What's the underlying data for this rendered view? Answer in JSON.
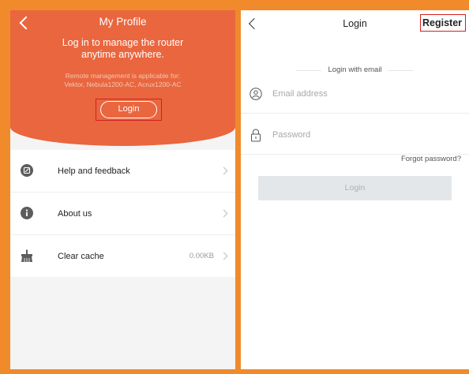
{
  "left": {
    "title": "My Profile",
    "tagline_line1": "Log in to manage the router",
    "tagline_line2": "anytime anywhere.",
    "note_line1": "Remote management is applicable for:",
    "note_line2": "Vektor, Nebula1200-AC, Acrux1200-AC",
    "login_label": "Login",
    "menu": [
      {
        "label": "Help and feedback",
        "icon": "feedback-icon"
      },
      {
        "label": "About us",
        "icon": "info-icon"
      },
      {
        "label": "Clear cache",
        "value": "0.00KB",
        "icon": "broom-icon"
      }
    ],
    "colors": {
      "header": "#e9663f",
      "highlight": "#d32020",
      "frame": "#f08a2a"
    }
  },
  "right": {
    "title": "Login",
    "register_label": "Register",
    "divider_label": "Login with email",
    "email_placeholder": "Email address",
    "password_placeholder": "Password",
    "forgot_label": "Forgot password?",
    "login_button": "Login"
  }
}
